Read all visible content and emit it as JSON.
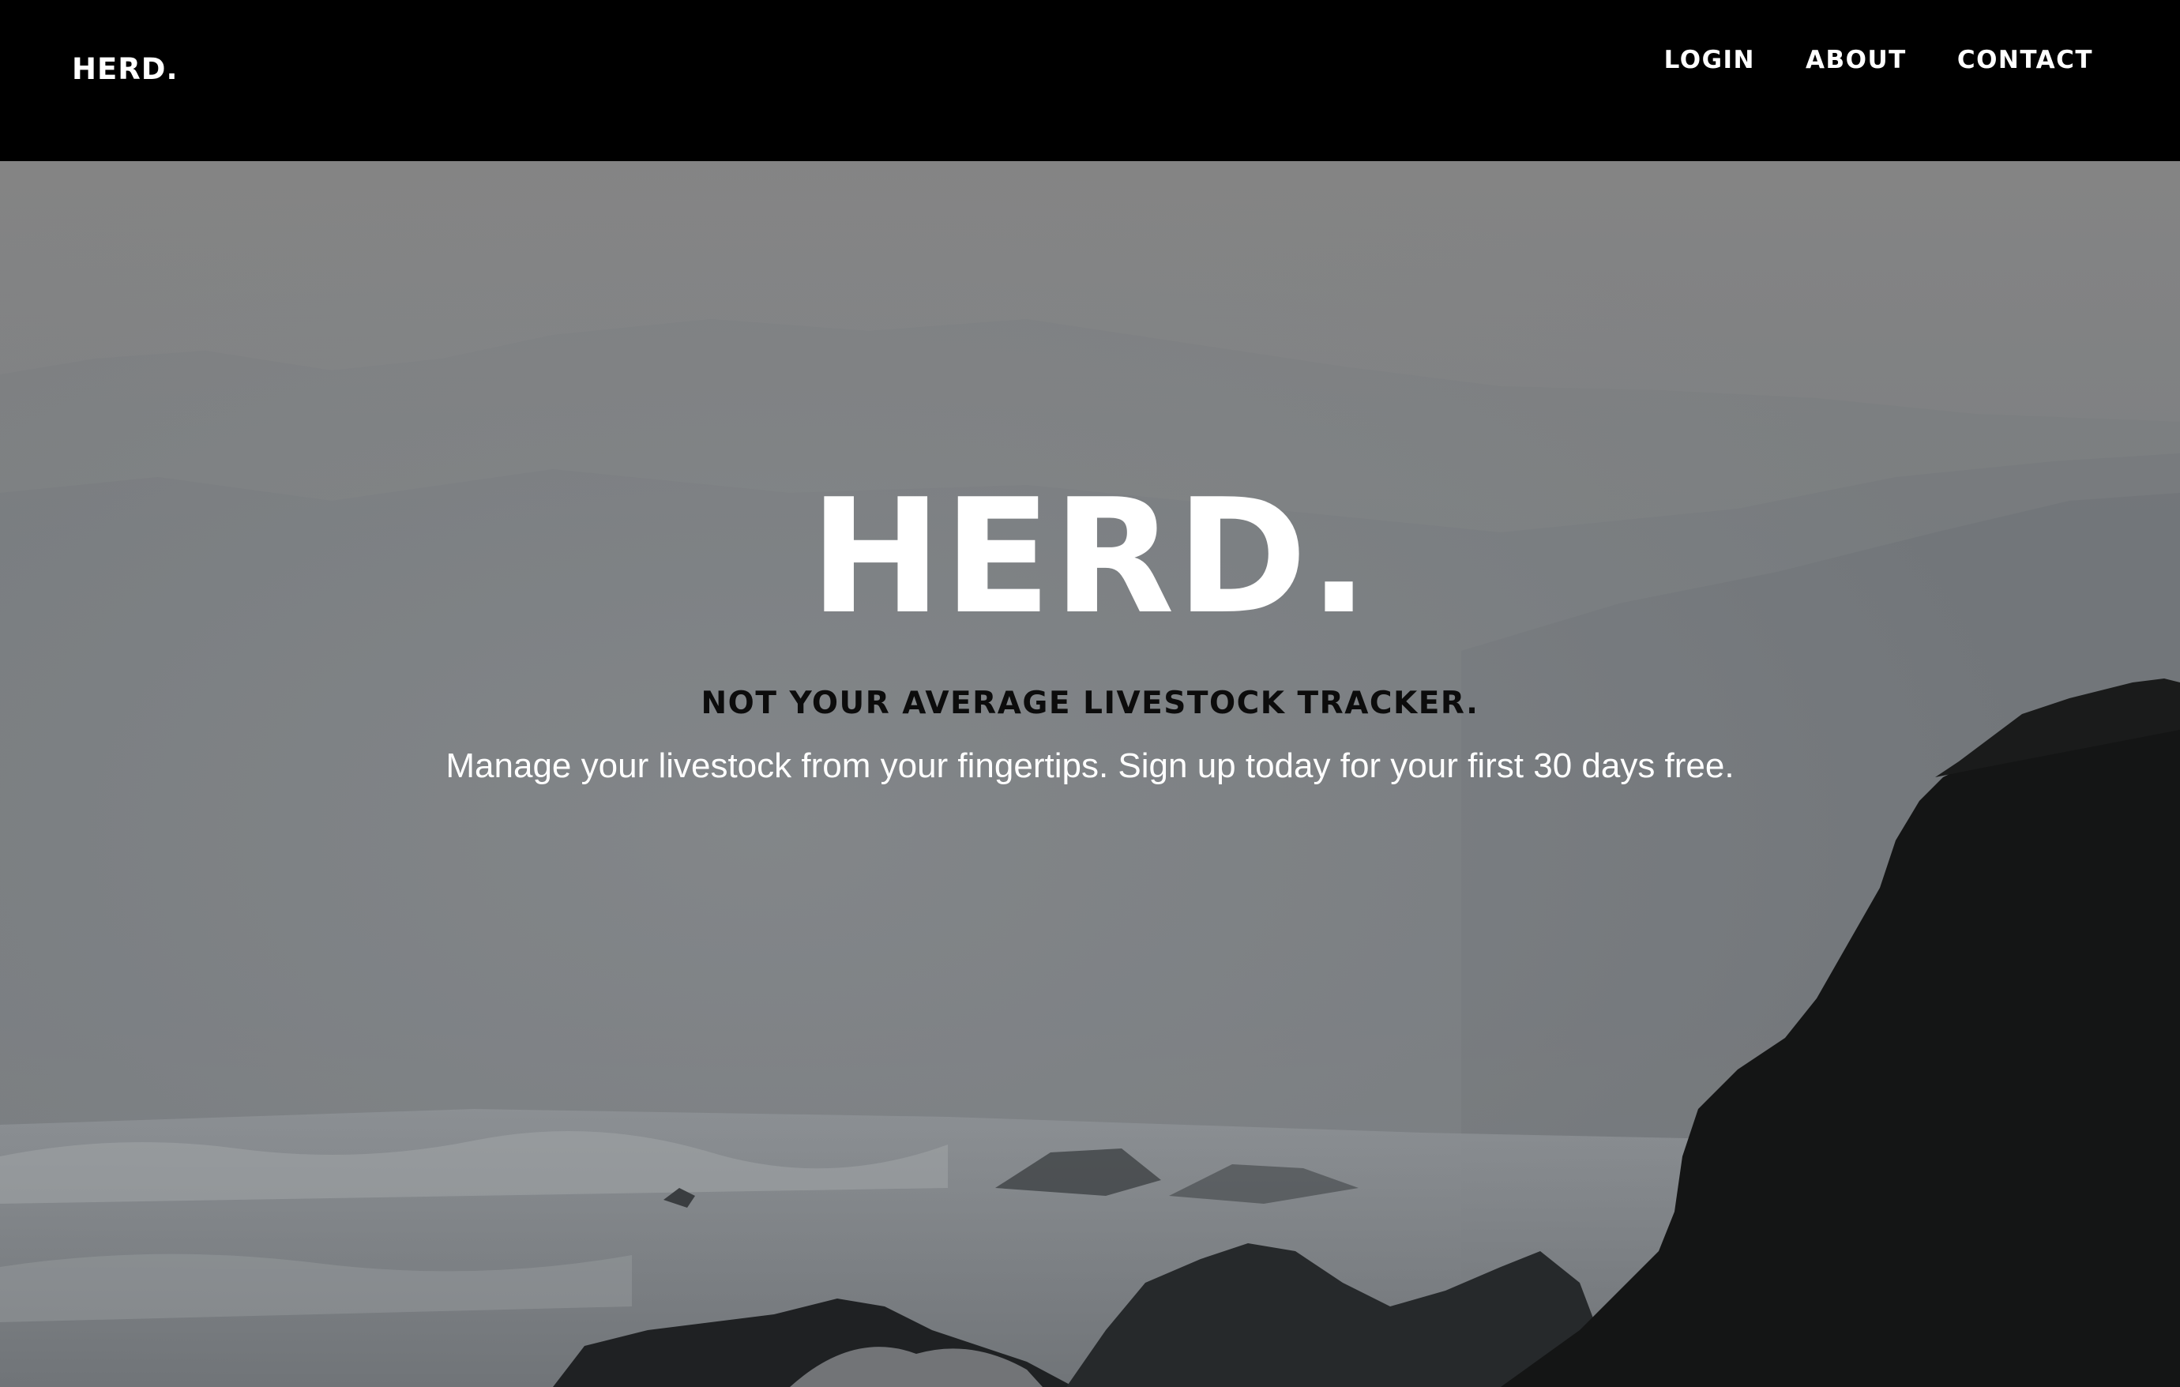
{
  "navbar": {
    "brand": "HERD.",
    "links": [
      {
        "label": "LOGIN"
      },
      {
        "label": "ABOUT"
      },
      {
        "label": "CONTACT"
      }
    ]
  },
  "hero": {
    "title": "HERD.",
    "tagline": "NOT YOUR AVERAGE LIVESTOCK TRACKER.",
    "subtitle": "Manage your livestock from your fingertips. Sign up today for your first 30 days free.",
    "background": "misty-coastal-landscape-image"
  },
  "colors": {
    "navbar_bg": "#000000",
    "text_light": "#ffffff",
    "tagline_text": "#0c0c0c"
  }
}
